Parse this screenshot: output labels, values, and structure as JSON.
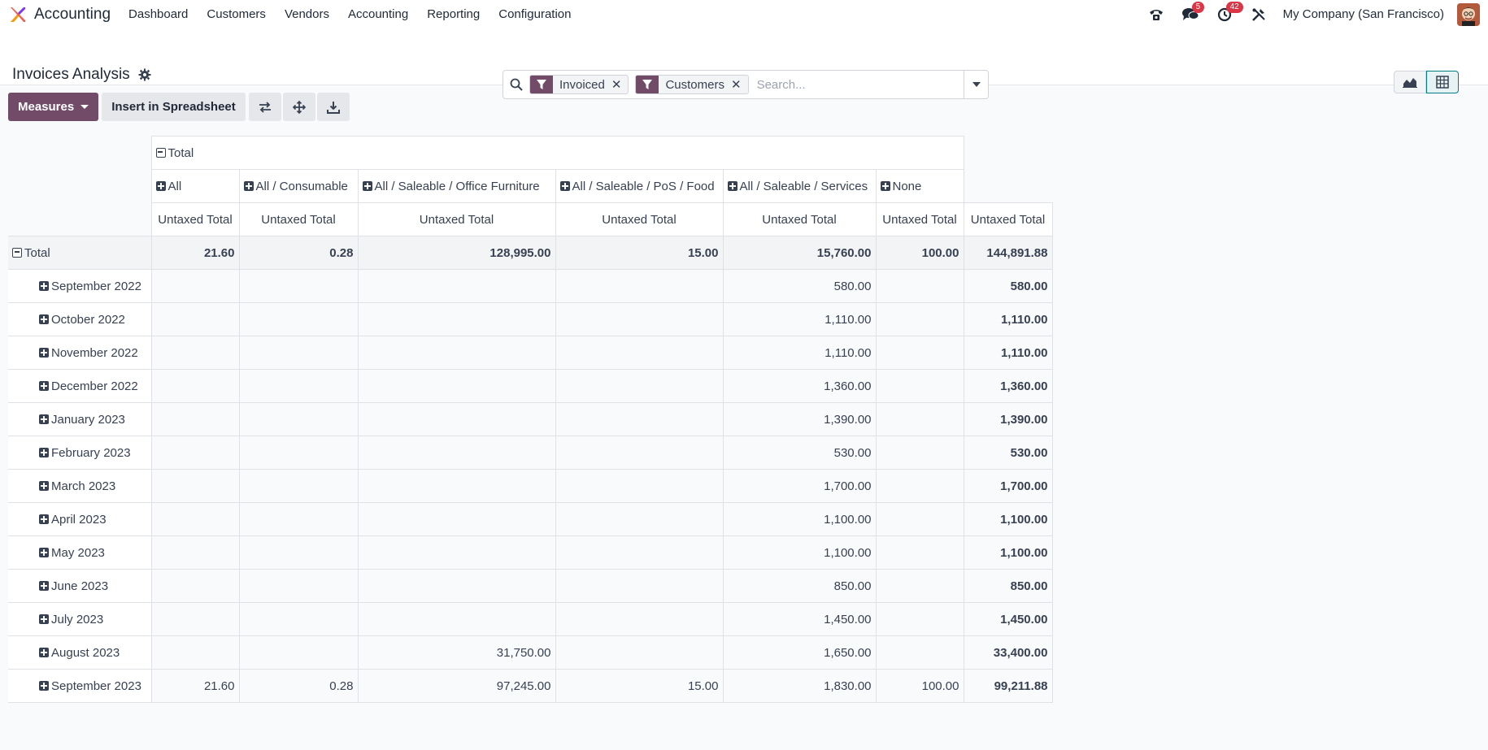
{
  "navbar": {
    "app_name": "Accounting",
    "menu": [
      "Dashboard",
      "Customers",
      "Vendors",
      "Accounting",
      "Reporting",
      "Configuration"
    ],
    "chat_count": "5",
    "activity_count": "42",
    "company": "My Company (San Francisco)"
  },
  "control": {
    "title": "Invoices Analysis",
    "facets": [
      "Invoiced",
      "Customers"
    ],
    "search_placeholder": "Search..."
  },
  "toolbar": {
    "measures_label": "Measures",
    "insert_label": "Insert in Spreadsheet"
  },
  "pivot": {
    "col_total_label": "Total",
    "columns": [
      "All",
      "All / Consumable",
      "All / Saleable / Office Furniture",
      "All / Saleable / PoS / Food",
      "All / Saleable / Services",
      "None"
    ],
    "measure": "Untaxed Total",
    "total_row": {
      "label": "Total",
      "values": [
        "21.60",
        "0.28",
        "128,995.00",
        "15.00",
        "15,760.00",
        "100.00",
        "144,891.88"
      ]
    },
    "rows": [
      {
        "label": "September 2022",
        "values": [
          "",
          "",
          "",
          "",
          "580.00",
          "",
          "580.00"
        ]
      },
      {
        "label": "October 2022",
        "values": [
          "",
          "",
          "",
          "",
          "1,110.00",
          "",
          "1,110.00"
        ]
      },
      {
        "label": "November 2022",
        "values": [
          "",
          "",
          "",
          "",
          "1,110.00",
          "",
          "1,110.00"
        ]
      },
      {
        "label": "December 2022",
        "values": [
          "",
          "",
          "",
          "",
          "1,360.00",
          "",
          "1,360.00"
        ]
      },
      {
        "label": "January 2023",
        "values": [
          "",
          "",
          "",
          "",
          "1,390.00",
          "",
          "1,390.00"
        ]
      },
      {
        "label": "February 2023",
        "values": [
          "",
          "",
          "",
          "",
          "530.00",
          "",
          "530.00"
        ]
      },
      {
        "label": "March 2023",
        "values": [
          "",
          "",
          "",
          "",
          "1,700.00",
          "",
          "1,700.00"
        ]
      },
      {
        "label": "April 2023",
        "values": [
          "",
          "",
          "",
          "",
          "1,100.00",
          "",
          "1,100.00"
        ]
      },
      {
        "label": "May 2023",
        "values": [
          "",
          "",
          "",
          "",
          "1,100.00",
          "",
          "1,100.00"
        ]
      },
      {
        "label": "June 2023",
        "values": [
          "",
          "",
          "",
          "",
          "850.00",
          "",
          "850.00"
        ]
      },
      {
        "label": "July 2023",
        "values": [
          "",
          "",
          "",
          "",
          "1,450.00",
          "",
          "1,450.00"
        ]
      },
      {
        "label": "August 2023",
        "values": [
          "",
          "",
          "31,750.00",
          "",
          "1,650.00",
          "",
          "33,400.00"
        ]
      },
      {
        "label": "September 2023",
        "values": [
          "21.60",
          "0.28",
          "97,245.00",
          "15.00",
          "1,830.00",
          "100.00",
          "99,211.88"
        ]
      }
    ]
  }
}
